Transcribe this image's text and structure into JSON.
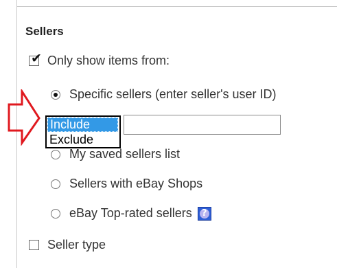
{
  "section": {
    "heading": "Sellers"
  },
  "only_show": {
    "label": "Only show items from:",
    "checked": true
  },
  "options": [
    {
      "label": "Specific sellers (enter seller's user ID)",
      "checked": true
    },
    {
      "label": "My saved sellers list",
      "checked": false
    },
    {
      "label": "Sellers with eBay Shops",
      "checked": false
    },
    {
      "label": "eBay Top-rated sellers",
      "checked": false
    }
  ],
  "seller_filter": {
    "options": [
      "Include",
      "Exclude"
    ],
    "selected": "Include",
    "input_value": ""
  },
  "help_icon": {
    "glyph": "?"
  },
  "seller_type": {
    "label": "Seller type",
    "checked": false
  },
  "annotation": {
    "arrow_color": "#e0191f"
  }
}
